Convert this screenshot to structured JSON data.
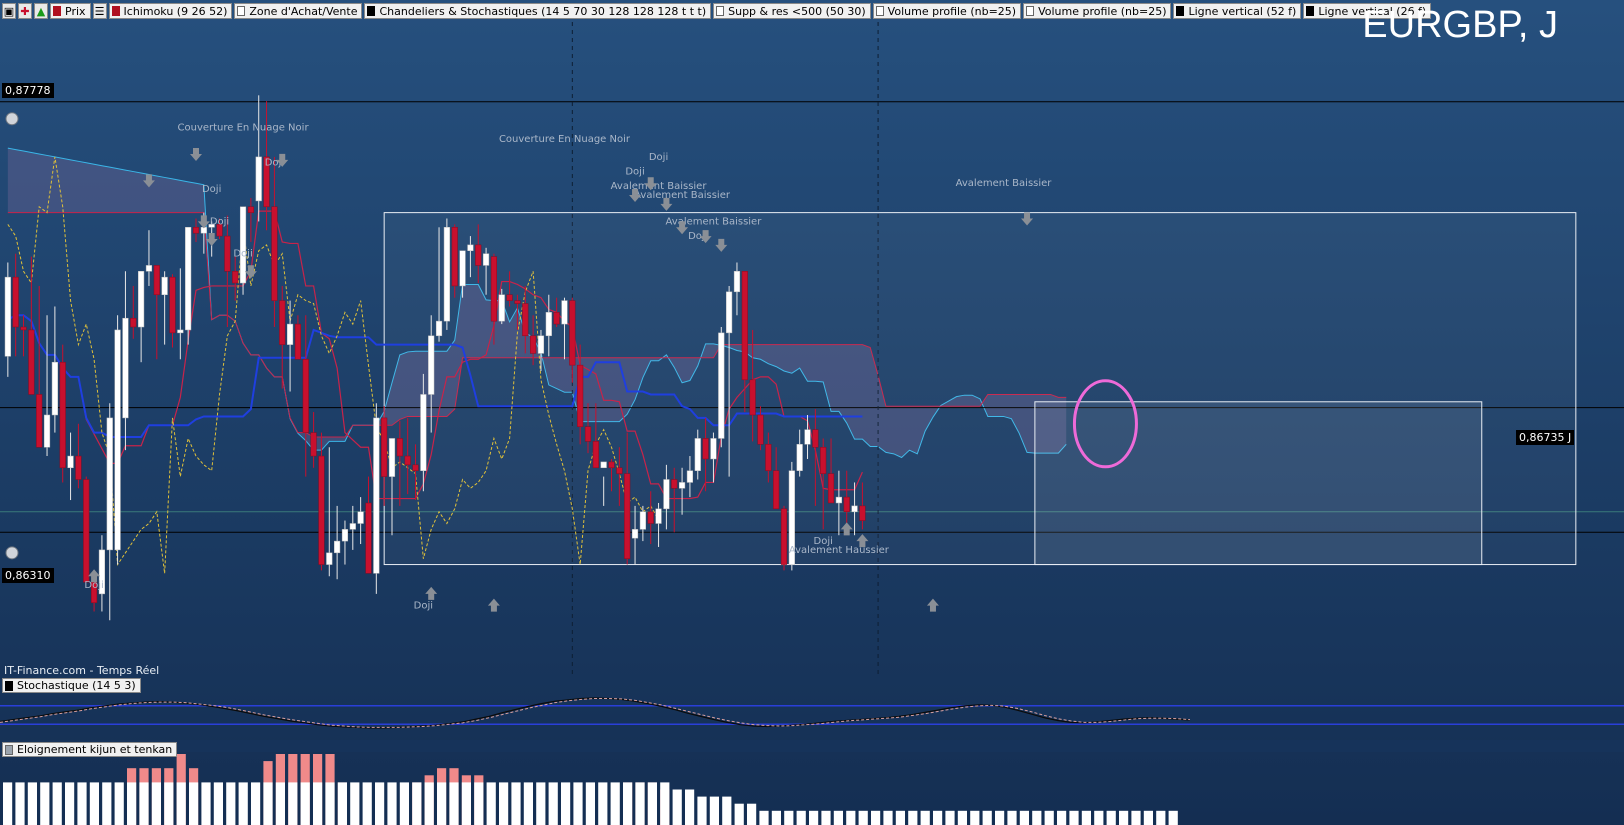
{
  "toolbar": {
    "price_label": "Prix",
    "indicators": [
      {
        "label": "Ichimoku (9 26 52)",
        "swatch": "red"
      },
      {
        "label": "Zone d'Achat/Vente",
        "swatch": "empty"
      },
      {
        "label": "Chandeliers & Stochastiques (14 5 70 30 128 128 128 t t t)",
        "swatch": "black"
      },
      {
        "label": "Supp & res <500 (50 30)",
        "swatch": "empty"
      },
      {
        "label": "Volume profile (nb=25)",
        "swatch": "empty"
      },
      {
        "label": "Volume profile (nb=25)",
        "swatch": "empty"
      },
      {
        "label": "Ligne vertical (52 f)",
        "swatch": "black"
      },
      {
        "label": "Ligne vertical (26 f)",
        "swatch": "black"
      }
    ]
  },
  "symbol": "EURGBP, J",
  "source": "IT-Finance.com - Temps Réel",
  "price_tags": {
    "top": "0,87778",
    "bottom": "0,86310",
    "current": "0,86735 J"
  },
  "stoch_panel": {
    "label": "Stochastique (14 5 3)"
  },
  "volume_panel": {
    "label": "Eloignement kijun et tenkan"
  },
  "colors": {
    "background": "#1b3a63",
    "bull_candle": "#ffffff",
    "bear_candle": "#c8102e",
    "kijun": "#1f3fe0",
    "tenkan": "#c8234a",
    "senkou": "#3ab6e8",
    "chikou": "#e0c13a",
    "highlight_circle": "#ee6ad8"
  },
  "annotations": [
    {
      "text": "Couverture En Nuage Noir",
      "x": 30,
      "y": 0.8768
    },
    {
      "text": "Couverture En Nuage Noir",
      "x": 71,
      "y": 0.8764
    },
    {
      "text": "Doji",
      "x": 34,
      "y": 0.8756
    },
    {
      "text": "Doji",
      "x": 26,
      "y": 0.8747
    },
    {
      "text": "Doji",
      "x": 27,
      "y": 0.8736
    },
    {
      "text": "Doji",
      "x": 30,
      "y": 0.8725
    },
    {
      "text": "Doji",
      "x": 83,
      "y": 0.8758
    },
    {
      "text": "Doji",
      "x": 80,
      "y": 0.8753
    },
    {
      "text": "Avalement Baissier",
      "x": 83,
      "y": 0.8748
    },
    {
      "text": "Avalement Baissier",
      "x": 86,
      "y": 0.8745
    },
    {
      "text": "Avalement Baissier",
      "x": 90,
      "y": 0.8736
    },
    {
      "text": "Doji",
      "x": 88,
      "y": 0.8731
    },
    {
      "text": "Avalement Baissier",
      "x": 127,
      "y": 0.8749
    },
    {
      "text": "Doji",
      "x": 11,
      "y": 0.8612
    },
    {
      "text": "Doji",
      "x": 53,
      "y": 0.8605
    },
    {
      "text": "Doji",
      "x": 104,
      "y": 0.8627
    },
    {
      "text": "Avalement Haussier",
      "x": 106,
      "y": 0.8624
    }
  ],
  "chart_data": [
    {
      "type": "candlestick",
      "title": "EURGBP, J",
      "ylim": [
        0.8582,
        0.8805
      ],
      "x_range": [
        0,
        200
      ],
      "reference_lines": [
        {
          "value": 0.87778,
          "label": "0,87778"
        },
        {
          "value": 0.8631,
          "label": "0,86310"
        },
        {
          "value": 0.86735,
          "label": "0,86735 J"
        }
      ],
      "vertical_lines": [
        72,
        111
      ],
      "highlight": {
        "x": 140,
        "y": 0.8668
      },
      "candles_x_start": 1,
      "candles": [
        [
          0.8691,
          0.8723,
          0.8684,
          0.8718
        ],
        [
          0.8718,
          0.8726,
          0.8691,
          0.8701
        ],
        [
          0.8701,
          0.8705,
          0.8691,
          0.87
        ],
        [
          0.87,
          0.8725,
          0.868,
          0.8678
        ],
        [
          0.8678,
          0.8715,
          0.8665,
          0.866
        ],
        [
          0.866,
          0.8705,
          0.8657,
          0.8671
        ],
        [
          0.8671,
          0.8708,
          0.8665,
          0.8689
        ],
        [
          0.8689,
          0.8695,
          0.8648,
          0.8653
        ],
        [
          0.8653,
          0.8665,
          0.8642,
          0.8657
        ],
        [
          0.8657,
          0.8668,
          0.8646,
          0.8649
        ],
        [
          0.8649,
          0.865,
          0.8614,
          0.8614
        ],
        [
          0.8614,
          0.861,
          0.8604,
          0.8607
        ],
        [
          0.861,
          0.863,
          0.8604,
          0.8625
        ],
        [
          0.8625,
          0.8675,
          0.8601,
          0.867
        ],
        [
          0.8625,
          0.8705,
          0.862,
          0.87
        ],
        [
          0.867,
          0.872,
          0.8659,
          0.8704
        ],
        [
          0.8704,
          0.8715,
          0.8697,
          0.8701
        ],
        [
          0.8701,
          0.872,
          0.8689,
          0.872
        ],
        [
          0.872,
          0.8734,
          0.8715,
          0.8722
        ],
        [
          0.8722,
          0.8716,
          0.869,
          0.8712
        ],
        [
          0.8712,
          0.872,
          0.8695,
          0.8718
        ],
        [
          0.8718,
          0.8719,
          0.8694,
          0.8699
        ],
        [
          0.8699,
          0.8721,
          0.869,
          0.87
        ],
        [
          0.87,
          0.8725,
          0.8695,
          0.8735
        ],
        [
          0.8735,
          0.8738,
          0.873,
          0.8733
        ],
        [
          0.8733,
          0.874,
          0.8726,
          0.8735
        ],
        [
          0.8735,
          0.8737,
          0.8725,
          0.8736
        ],
        [
          0.8736,
          0.8738,
          0.8731,
          0.8732
        ],
        [
          0.8732,
          0.8739,
          0.8701,
          0.872
        ],
        [
          0.872,
          0.8725,
          0.871,
          0.8716
        ],
        [
          0.8716,
          0.873,
          0.8712,
          0.8742
        ],
        [
          0.8742,
          0.8745,
          0.873,
          0.874
        ],
        [
          0.8744,
          0.878,
          0.8737,
          0.8759
        ],
        [
          0.8759,
          0.8778,
          0.8734,
          0.8742
        ],
        [
          0.8742,
          0.8759,
          0.8701,
          0.871
        ],
        [
          0.871,
          0.8715,
          0.868,
          0.8695
        ],
        [
          0.8695,
          0.871,
          0.8679,
          0.8702
        ],
        [
          0.8702,
          0.8705,
          0.869,
          0.869
        ],
        [
          0.869,
          0.8705,
          0.865,
          0.8665
        ],
        [
          0.8665,
          0.8672,
          0.8653,
          0.8657
        ],
        [
          0.8657,
          0.8665,
          0.8618,
          0.862
        ],
        [
          0.862,
          0.866,
          0.8616,
          0.8624
        ],
        [
          0.8624,
          0.864,
          0.8615,
          0.8628
        ],
        [
          0.8628,
          0.8635,
          0.862,
          0.8632
        ],
        [
          0.8632,
          0.864,
          0.8625,
          0.8634
        ],
        [
          0.8634,
          0.8643,
          0.8627,
          0.8638
        ],
        [
          0.8641,
          0.865,
          0.862,
          0.8617
        ],
        [
          0.8617,
          0.8675,
          0.861,
          0.867
        ],
        [
          0.867,
          0.8674,
          0.864,
          0.865
        ],
        [
          0.865,
          0.866,
          0.863,
          0.8663
        ],
        [
          0.8663,
          0.8669,
          0.864,
          0.8657
        ],
        [
          0.8657,
          0.867,
          0.8644,
          0.8654
        ],
        [
          0.8654,
          0.8661,
          0.8642,
          0.8652
        ],
        [
          0.8652,
          0.8685,
          0.8645,
          0.8678
        ],
        [
          0.8678,
          0.8705,
          0.8665,
          0.8698
        ],
        [
          0.8698,
          0.8735,
          0.8696,
          0.8703
        ],
        [
          0.8703,
          0.8738,
          0.87,
          0.8735
        ],
        [
          0.8735,
          0.8736,
          0.8711,
          0.8715
        ],
        [
          0.8715,
          0.8726,
          0.8711,
          0.8727
        ],
        [
          0.8727,
          0.8732,
          0.8718,
          0.8729
        ],
        [
          0.8729,
          0.8736,
          0.8716,
          0.8722
        ],
        [
          0.8722,
          0.8728,
          0.8712,
          0.8726
        ],
        [
          0.8725,
          0.8726,
          0.8695,
          0.8703
        ],
        [
          0.8703,
          0.8714,
          0.8702,
          0.8712
        ],
        [
          0.8712,
          0.872,
          0.8708,
          0.871
        ],
        [
          0.871,
          0.8712,
          0.87,
          0.8709
        ],
        [
          0.8709,
          0.8715,
          0.8692,
          0.8698
        ],
        [
          0.8698,
          0.8705,
          0.8688,
          0.8692
        ],
        [
          0.8692,
          0.87,
          0.8686,
          0.8698
        ],
        [
          0.8698,
          0.8712,
          0.8691,
          0.8706
        ],
        [
          0.8706,
          0.8711,
          0.8701,
          0.8702
        ],
        [
          0.8702,
          0.8711,
          0.869,
          0.871
        ],
        [
          0.871,
          0.8711,
          0.8682,
          0.8688
        ],
        [
          0.8688,
          0.8695,
          0.8661,
          0.8667
        ],
        [
          0.8667,
          0.8675,
          0.8658,
          0.8662
        ],
        [
          0.8662,
          0.8675,
          0.8658,
          0.8653
        ],
        [
          0.8653,
          0.865,
          0.864,
          0.8655
        ],
        [
          0.8655,
          0.8656,
          0.8645,
          0.8653
        ],
        [
          0.8653,
          0.866,
          0.864,
          0.8651
        ],
        [
          0.8651,
          0.8665,
          0.862,
          0.8622
        ],
        [
          0.8629,
          0.864,
          0.862,
          0.8632
        ],
        [
          0.8632,
          0.864,
          0.8628,
          0.8638
        ],
        [
          0.8638,
          0.8645,
          0.8627,
          0.8634
        ],
        [
          0.8634,
          0.8641,
          0.8626,
          0.8639
        ],
        [
          0.8639,
          0.8654,
          0.8632,
          0.8649
        ],
        [
          0.8649,
          0.8653,
          0.8631,
          0.8646
        ],
        [
          0.8646,
          0.8653,
          0.8637,
          0.8648
        ],
        [
          0.8648,
          0.8657,
          0.8643,
          0.8652
        ],
        [
          0.8652,
          0.8666,
          0.8649,
          0.8663
        ],
        [
          0.8663,
          0.867,
          0.8645,
          0.8656
        ],
        [
          0.8656,
          0.8665,
          0.8648,
          0.8663
        ],
        [
          0.8663,
          0.8701,
          0.866,
          0.8699
        ],
        [
          0.8699,
          0.8715,
          0.865,
          0.8713
        ],
        [
          0.8713,
          0.8723,
          0.8705,
          0.872
        ],
        [
          0.872,
          0.872,
          0.8672,
          0.8683
        ],
        [
          0.8683,
          0.87,
          0.8662,
          0.8671
        ],
        [
          0.8671,
          0.8674,
          0.8659,
          0.8661
        ],
        [
          0.8661,
          0.8665,
          0.8648,
          0.8652
        ],
        [
          0.8652,
          0.866,
          0.864,
          0.8639
        ],
        [
          0.8639,
          0.864,
          0.8618,
          0.862
        ],
        [
          0.862,
          0.8655,
          0.8618,
          0.8652
        ],
        [
          0.8652,
          0.8666,
          0.865,
          0.8661
        ],
        [
          0.8661,
          0.8671,
          0.8656,
          0.8666
        ],
        [
          0.8666,
          0.8673,
          0.864,
          0.866
        ],
        [
          0.866,
          0.8663,
          0.8632,
          0.8651
        ],
        [
          0.8651,
          0.8663,
          0.8644,
          0.8641
        ],
        [
          0.8641,
          0.8652,
          0.863,
          0.8643
        ],
        [
          0.8643,
          0.8652,
          0.8631,
          0.8638
        ],
        [
          0.8638,
          0.8648,
          0.863,
          0.864
        ],
        [
          0.864,
          0.8648,
          0.8632,
          0.8635
        ]
      ]
    },
    {
      "type": "line",
      "title": "Stochastique (14 5 3)",
      "ylim": [
        0,
        100
      ],
      "levels": [
        70,
        30
      ],
      "series": [
        {
          "values": [
            36,
            40,
            44,
            48,
            53,
            57,
            61,
            66,
            70,
            74,
            76,
            78,
            79,
            78,
            76,
            73,
            69,
            64,
            59,
            53,
            47,
            42,
            37,
            33,
            29,
            26,
            24,
            23,
            22,
            22,
            23,
            24,
            26,
            28,
            31,
            35,
            41,
            47,
            55,
            62,
            69,
            75,
            80,
            83,
            86,
            87,
            86,
            84,
            80,
            75,
            69,
            62,
            54,
            47,
            40,
            34,
            29,
            26,
            25,
            26,
            28,
            30,
            33,
            36,
            38,
            40,
            42,
            44,
            47,
            51,
            56,
            61,
            66,
            70,
            72,
            71,
            67,
            60,
            52,
            44,
            38,
            34,
            33,
            35,
            38,
            41,
            43,
            44,
            43,
            41,
            39
          ]
        },
        {
          "values": [
            34,
            38,
            42,
            46,
            51,
            55,
            59,
            64,
            68,
            72,
            75,
            77,
            78,
            78,
            77,
            74,
            71,
            67,
            62,
            56,
            50,
            45,
            40,
            36,
            32,
            28,
            26,
            24,
            23,
            23,
            23,
            24,
            25,
            27,
            30,
            33,
            38,
            44,
            51,
            58,
            65,
            71,
            77,
            81,
            84,
            86,
            86,
            85,
            82,
            77,
            72,
            65,
            58,
            51,
            44,
            38,
            33,
            29,
            27,
            26,
            27,
            29,
            31,
            34,
            37,
            39,
            41,
            43,
            45,
            49,
            53,
            58,
            63,
            67,
            70,
            71,
            69,
            64,
            57,
            49,
            42,
            37,
            34,
            34,
            36,
            39,
            42,
            43,
            43,
            42,
            40
          ]
        }
      ]
    },
    {
      "type": "bar",
      "title": "Eloignement kijun et tenkan",
      "ylim": [
        0,
        10
      ],
      "values": [
        6,
        6,
        6,
        6,
        6,
        6,
        6,
        6,
        6,
        6,
        6,
        6,
        6,
        6,
        6,
        6,
        6,
        6,
        6,
        6,
        6,
        7,
        8,
        8,
        8,
        8,
        8,
        8,
        8,
        8,
        8,
        9,
        10,
        9,
        8,
        7,
        6,
        6,
        6,
        6,
        6,
        6,
        6,
        6,
        6,
        6,
        6,
        7,
        9,
        10,
        10,
        10,
        10,
        10,
        10,
        10,
        10,
        10,
        10,
        10,
        9,
        8,
        6,
        6,
        6,
        6,
        6,
        6,
        6,
        6,
        6,
        6,
        6,
        6,
        6,
        6,
        6,
        7,
        7,
        8,
        8,
        8,
        8,
        8,
        8,
        7,
        7,
        7,
        6,
        6,
        6,
        6,
        6,
        6,
        6,
        6,
        6,
        6,
        6,
        6,
        6,
        6,
        6,
        6,
        6,
        6,
        6,
        6,
        6,
        6,
        6,
        6,
        6,
        6,
        6,
        6,
        6,
        6,
        6,
        6,
        5,
        5,
        5,
        5,
        5,
        5,
        5,
        5,
        4,
        4,
        4,
        4,
        4,
        4,
        3,
        3,
        3,
        3,
        3,
        3,
        2,
        2,
        2,
        2,
        2,
        2,
        2,
        2,
        2,
        2,
        2,
        2,
        2,
        2,
        2,
        2,
        2,
        2,
        2,
        2,
        2,
        2,
        2,
        2,
        2,
        2,
        2,
        2,
        2,
        2,
        2,
        2,
        2,
        2,
        2,
        2,
        2,
        2,
        2,
        2,
        2,
        2,
        2,
        2,
        2,
        2,
        2,
        2,
        2,
        2,
        2,
        2,
        2,
        2,
        2,
        2,
        2,
        2,
        2,
        2,
        2,
        2,
        2,
        2,
        2,
        2,
        2,
        2,
        2,
        2,
        2,
        2,
        2,
        2,
        2,
        2,
        2,
        2,
        2
      ],
      "highlighted_ranges": [
        [
          21,
          35
        ],
        [
          47,
          62
        ],
        [
          76,
          87
        ],
        [
          114,
          123
        ]
      ]
    }
  ]
}
